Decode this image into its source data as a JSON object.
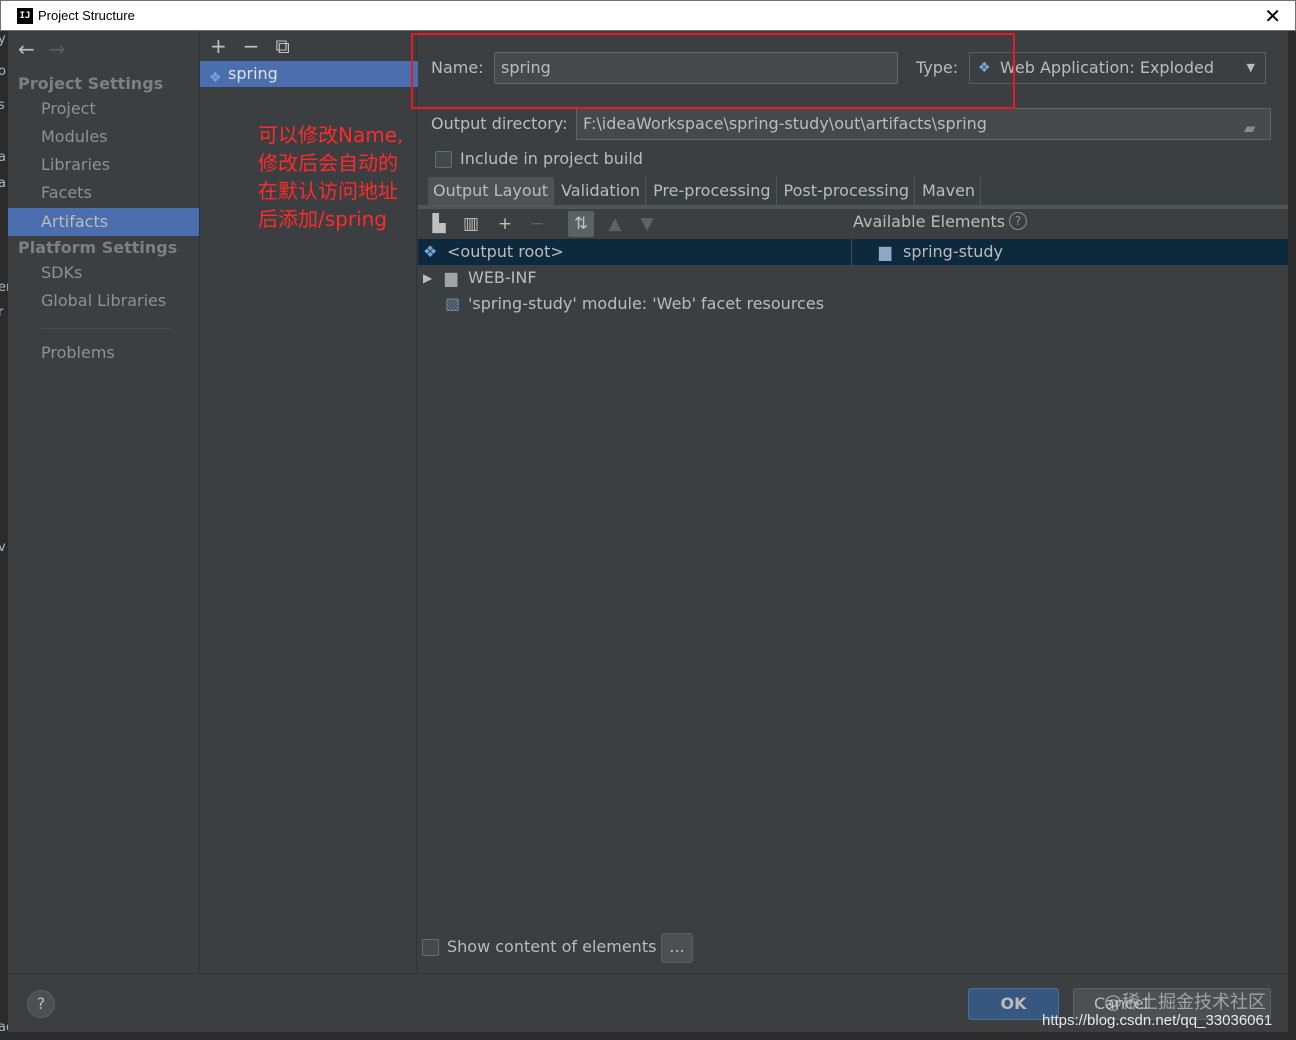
{
  "window": {
    "title": "Project Structure",
    "close_icon": "close-icon",
    "app_icon_text": "IJ"
  },
  "edge_strip": {
    "fragments": [
      "y",
      "o",
      "s",
      "a",
      "a",
      "er",
      "r",
      "v",
      "ag"
    ]
  },
  "nav": {
    "back_icon": "←",
    "forward_icon": "→",
    "project_settings_title": "Project Settings",
    "project_items": [
      "Project",
      "Modules",
      "Libraries",
      "Facets",
      "Artifacts"
    ],
    "selected": "Artifacts",
    "platform_settings_title": "Platform Settings",
    "platform_items": [
      "SDKs",
      "Global Libraries"
    ],
    "problems": "Problems"
  },
  "artifacts": {
    "toolbar": {
      "add": "+",
      "remove": "−",
      "copy": "⧉"
    },
    "items": [
      "spring"
    ]
  },
  "annotation": "可以修改Name,修改后会自动的在默认访问地址后添加/spring",
  "form": {
    "name_label": "Name:",
    "name_value": "spring",
    "type_label": "Type:",
    "type_value": "Web Application: Exploded",
    "output_dir_label": "Output directory:",
    "output_dir_value": "F:\\ideaWorkspace\\spring-study\\out\\artifacts\\spring",
    "include_build_label": "Include in project build",
    "include_build_checked": false
  },
  "tabs": [
    "Output Layout",
    "Validation",
    "Pre-processing",
    "Post-processing",
    "Maven"
  ],
  "active_tab": "Output Layout",
  "available_elements_label": "Available Elements",
  "output_tree": [
    {
      "label": "<output root>",
      "icon": "artifact-root-icon",
      "selected": true
    },
    {
      "label": "WEB-INF",
      "icon": "folder-icon",
      "expandable": true
    },
    {
      "label": "'spring-study' module: 'Web' facet resources",
      "icon": "web-facet-icon"
    }
  ],
  "available_tree": [
    {
      "label": "spring-study",
      "icon": "module-folder-icon",
      "selected": true
    }
  ],
  "show_content_label": "Show content of elements",
  "show_content_checked": false,
  "ellipsis": "...",
  "footer": {
    "help": "?",
    "ok": "OK",
    "cancel": "Cancel",
    "watermark_cn": "@稀土掘金技术社区",
    "watermark_url": "https://blog.csdn.net/qq_33036061"
  },
  "colors": {
    "background": "#3c3f41",
    "selection": "#4b6eaf",
    "tree_selection": "#0d293e",
    "annotation": "#ff2a2a",
    "highlight_box": "#e81b23",
    "ok_button": "#365880"
  }
}
